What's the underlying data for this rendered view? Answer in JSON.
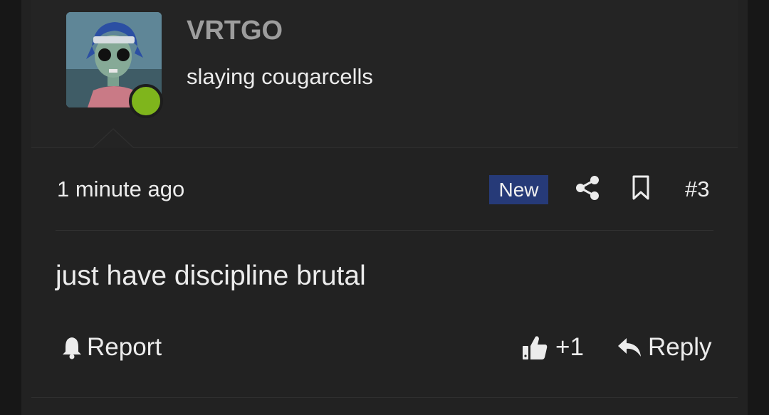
{
  "user": {
    "name": "VRTGO",
    "title": "slaying cougarcells",
    "online_color": "#7fb51c",
    "avatar_icon": "avatar-cartoon-character"
  },
  "meta": {
    "timestamp": "1 minute ago",
    "badge": "New",
    "badge_color": "#263a78",
    "post_number": "#3",
    "share_icon": "share-icon",
    "bookmark_icon": "bookmark-icon"
  },
  "message": {
    "text": "just have discipline brutal"
  },
  "actions": {
    "report_label": "Report",
    "like_label": "+1",
    "reply_label": "Reply",
    "report_icon": "bell-icon",
    "like_icon": "thumbs-up-icon",
    "reply_icon": "reply-arrow-icon"
  }
}
